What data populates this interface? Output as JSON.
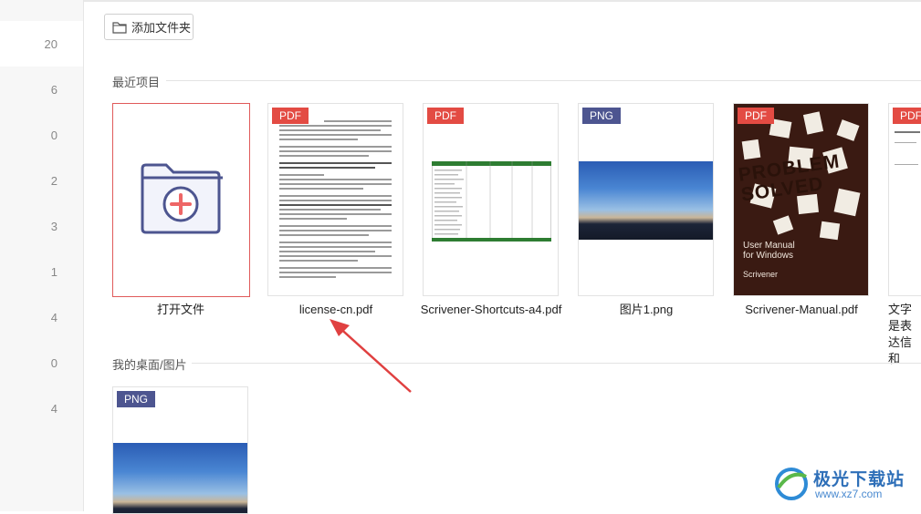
{
  "sidebar": {
    "counts": [
      "20",
      "6",
      "0",
      "2",
      "3",
      "1",
      "4",
      "0",
      "4"
    ]
  },
  "toolbar": {
    "add_folder_label": "添加文件夹"
  },
  "recent": {
    "title": "最近项目",
    "open_file_label": "打开文件",
    "items": [
      {
        "badge": "PDF",
        "name": "license-cn.pdf"
      },
      {
        "badge": "PDF",
        "name": "Scrivener-Shortcuts-a4.pdf"
      },
      {
        "badge": "PNG",
        "name": "图片1.png"
      },
      {
        "badge": "PDF",
        "name": "Scrivener-Manual.pdf",
        "cover_title": "PROBLEM SOLVED",
        "cover_subtitle": "User Manual for Windows",
        "cover_brand": "Scrivener"
      },
      {
        "badge": "PDF",
        "name": "文字是表达信和"
      }
    ]
  },
  "desktop": {
    "title": "我的桌面/图片",
    "items": [
      {
        "badge": "PNG"
      }
    ]
  },
  "watermark": {
    "brand": "极光下载站",
    "url": "www.xz7.com"
  },
  "colors": {
    "pdf_badge": "#e34b43",
    "png_badge": "#4d5590",
    "accent_red": "#e05a5a",
    "arrow": "#e04040"
  }
}
